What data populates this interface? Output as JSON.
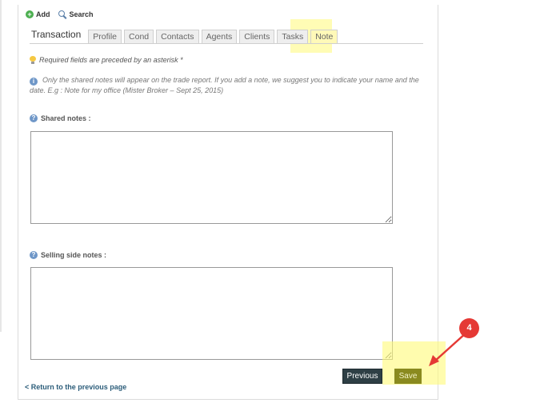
{
  "toolbar": {
    "add_label": "Add",
    "search_label": "Search"
  },
  "tabs": {
    "main": "Transaction",
    "items": [
      {
        "label": "Profile"
      },
      {
        "label": "Cond"
      },
      {
        "label": "Contacts"
      },
      {
        "label": "Agents"
      },
      {
        "label": "Clients"
      },
      {
        "label": "Tasks"
      },
      {
        "label": "Note",
        "active": true
      }
    ]
  },
  "notice": {
    "required": "Required fields are preceded by an asterisk *",
    "shared_info": "Only the shared notes will appear on the trade report. If you add a note, we suggest you to indicate your name and the date. E.g : Note for my office (Mister Broker – Sept 25, 2015)"
  },
  "fields": {
    "shared_notes_label": "Shared notes :",
    "shared_notes_value": "",
    "selling_notes_label": "Selling side notes :",
    "selling_notes_value": ""
  },
  "actions": {
    "previous": "Previous",
    "save": "Save",
    "back_link": "< Return to the previous page"
  },
  "annotation": {
    "step": "4",
    "highlight_color": "#fff77a",
    "badge_color": "#e53935"
  },
  "icons": {
    "add": "plus-circle-icon",
    "search": "magnifier-icon",
    "tip": "lightbulb-icon",
    "info": "info-icon",
    "help": "question-icon"
  }
}
